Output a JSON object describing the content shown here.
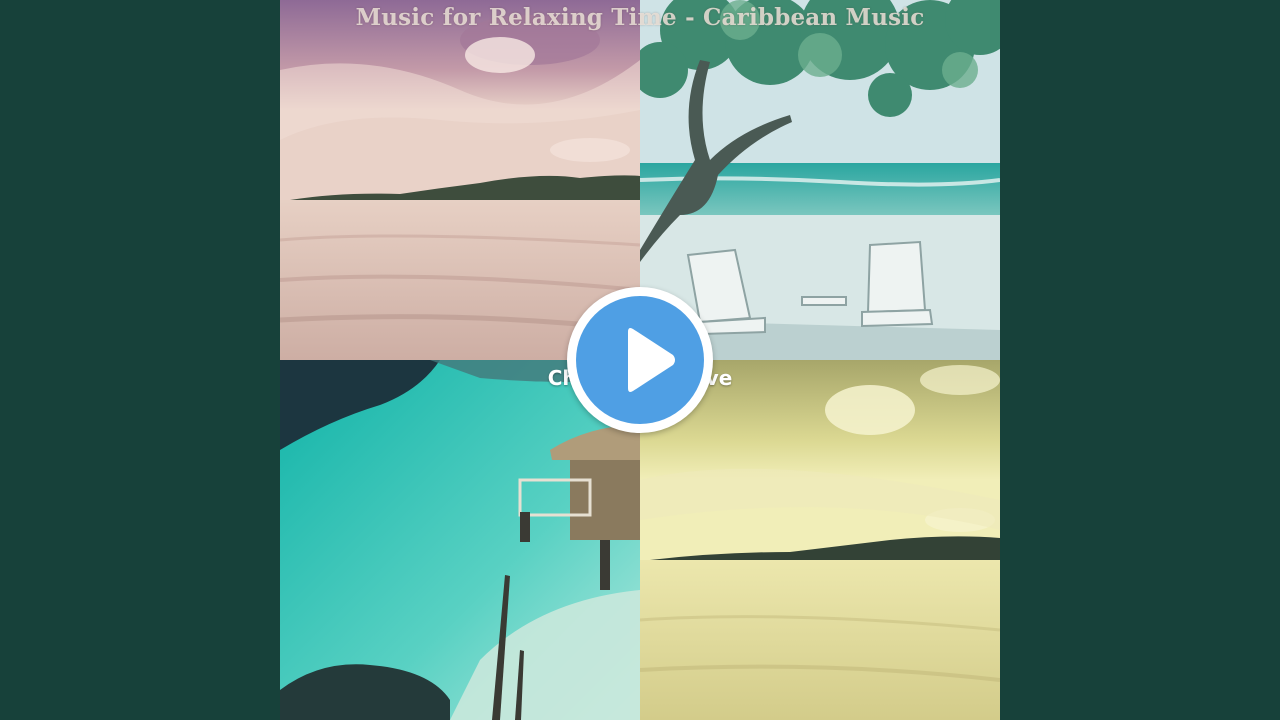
{
  "cover": {
    "top_title": "Music for Relaxing Time - Caribbean Music",
    "middle_title": "Chill Out Groove"
  },
  "player": {
    "play_button_icon": "play-icon",
    "accent_color": "#4f9fe4"
  },
  "colors": {
    "background": "#17413a"
  }
}
